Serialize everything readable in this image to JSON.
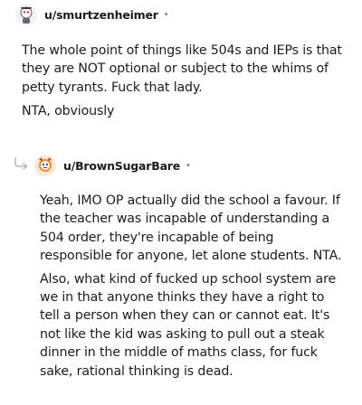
{
  "comments": [
    {
      "username": "u/smurtzenheimer",
      "separator": "•",
      "avatar_icon": "snoo-avatar-icon",
      "paragraphs": [
        "The whole point of things like 504s and IEPs is that they are NOT optional or subject to the whims of petty tyrants. Fuck that lady.",
        "NTA, obviously"
      ]
    },
    {
      "username": "u/BrownSugarBare",
      "separator": "•",
      "avatar_icon": "snoo-avatar-icon",
      "reply_icon": "reply-arrow-icon",
      "paragraphs": [
        "Yeah, IMO OP actually did the school a favour. If the teacher was incapable of understanding a 504 order, they're incapable of being responsible for anyone, let alone students. NTA.",
        "Also, what kind of fucked up school system are we in that anyone thinks they have a right to tell a person when they can or cannot eat. It's not like the kid was asking to pull out a steak dinner in the middle of maths class, for fuck sake, rational thinking is dead."
      ]
    }
  ],
  "colors": {
    "text": "#1c1c1c",
    "meta": "#7c7c7c",
    "reply_arrow": "#b0b8c0"
  }
}
